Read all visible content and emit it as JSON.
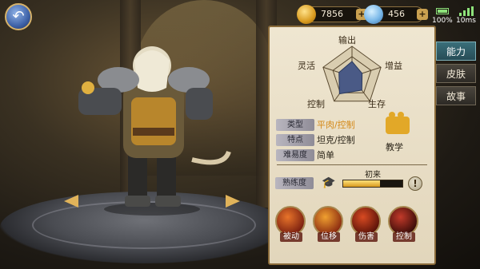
{
  "resources": {
    "gold": "7856",
    "gems": "456"
  },
  "status": {
    "battery": "100%",
    "ping": "10ms"
  },
  "radar": {
    "labels": {
      "top": "输出",
      "right": "增益",
      "bottom_right": "生存",
      "bottom_left": "控制",
      "left": "灵活"
    },
    "values": [
      0.5,
      0.35,
      0.55,
      0.7,
      0.45
    ]
  },
  "info": {
    "type_tag": "类型",
    "type_value": "平肉/控制",
    "feature_tag": "特点",
    "feature_value": "坦克/控制",
    "difficulty_tag": "难易度",
    "difficulty_value": "简单"
  },
  "teach_label": "教学",
  "mastery": {
    "tag": "熟练度",
    "level": "初来",
    "progress": 0.62
  },
  "skills": [
    {
      "label": "被动",
      "color1": "#e8742a",
      "color2": "#7a1f10"
    },
    {
      "label": "位移",
      "color1": "#f0a030",
      "color2": "#8a2a10"
    },
    {
      "label": "伤害",
      "color1": "#d84a22",
      "color2": "#5a1208"
    },
    {
      "label": "控制",
      "color1": "#c23a2a",
      "color2": "#3a0c08"
    }
  ],
  "tabs": [
    "能力",
    "皮肤",
    "故事"
  ],
  "colors": {
    "accent": "#d89a1e",
    "panel": "#efe6d1",
    "active_tab": "#3a6f7a"
  }
}
